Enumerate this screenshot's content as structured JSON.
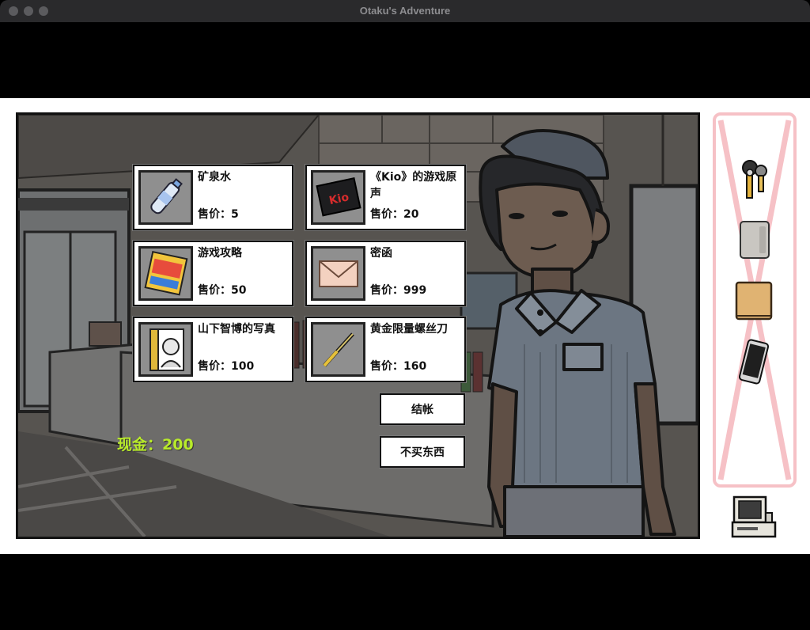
{
  "window": {
    "title": "Otaku's Adventure"
  },
  "shop": {
    "items": [
      {
        "name": "矿泉水",
        "price_label": "售价：5",
        "icon": "water-bottle-icon"
      },
      {
        "name": "《Kio》的游戏原声",
        "price_label": "售价：20",
        "icon": "cd-case-icon"
      },
      {
        "name": "游戏攻略",
        "price_label": "售价：50",
        "icon": "game-guide-book-icon"
      },
      {
        "name": "密函",
        "price_label": "售价：999",
        "icon": "envelope-icon"
      },
      {
        "name": "山下智博的写真",
        "price_label": "售价：100",
        "icon": "photo-book-icon"
      },
      {
        "name": "黄金限量螺丝刀",
        "price_label": "售价：160",
        "icon": "screwdriver-icon"
      }
    ],
    "cd_label": "Kio",
    "checkout_label": "结帐",
    "leave_label": "不买东西",
    "cash_label": "现金：200"
  },
  "inventory": {
    "items": [
      "keys-icon",
      "power-bank-icon",
      "wallet-icon",
      "smartphone-icon"
    ],
    "computer": "computer-icon"
  },
  "colors": {
    "cash_text": "#b8ea2a",
    "inventory_border": "#f6c1c6",
    "scene_bg": "#5a5752"
  }
}
